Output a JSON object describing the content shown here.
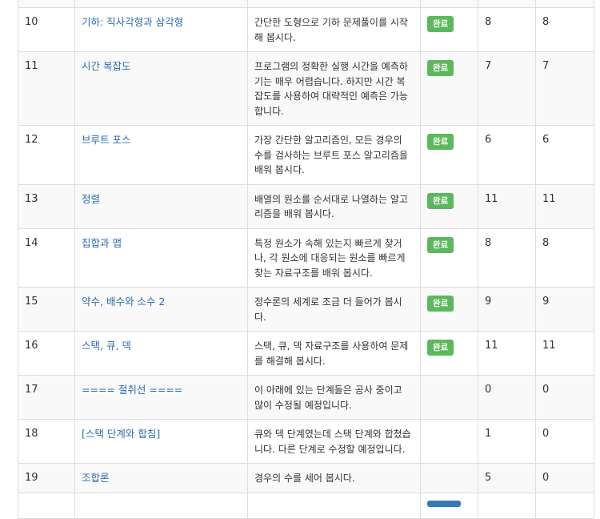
{
  "rows": [
    {
      "num": "10",
      "title": "기하: 직사각형과 삼각형",
      "desc": "간단한 도형으로 기하 문제풀이를 시작해 봅시다.",
      "status": "완료",
      "a": "8",
      "b": "8"
    },
    {
      "num": "11",
      "title": "시간 복잡도",
      "desc": "프로그램의 정확한 실행 시간을 예측하기는 매우 어렵습니다. 하지만 시간 복잡도를 사용하여 대략적인 예측은 가능합니다.",
      "status": "완료",
      "a": "7",
      "b": "7"
    },
    {
      "num": "12",
      "title": "브루트 포스",
      "desc": "가장 간단한 알고리즘인, 모든 경우의 수를 검사하는 브루트 포스 알고리즘을 배워 봅시다.",
      "status": "완료",
      "a": "6",
      "b": "6"
    },
    {
      "num": "13",
      "title": "정렬",
      "desc": "배열의 원소를 순서대로 나열하는 알고리즘을 배워 봅시다.",
      "status": "완료",
      "a": "11",
      "b": "11"
    },
    {
      "num": "14",
      "title": "집합과 맵",
      "desc": "특정 원소가 속해 있는지 빠르게 찾거나, 각 원소에 대응되는 원소를 빠르게 찾는 자료구조를 배워 봅시다.",
      "status": "완료",
      "a": "8",
      "b": "8"
    },
    {
      "num": "15",
      "title": "약수, 배수와 소수 2",
      "desc": "정수론의 세계로 조금 더 들어가 봅시다.",
      "status": "완료",
      "a": "9",
      "b": "9"
    },
    {
      "num": "16",
      "title": "스택, 큐, 덱",
      "desc": "스택, 큐, 덱 자료구조를 사용하여 문제를 해결해 봅시다.",
      "status": "완료",
      "a": "11",
      "b": "11"
    },
    {
      "num": "17",
      "title": "==== 절취선 ====",
      "desc": "이 아래에 있는 단계들은 공사 중이고 많이 수정될 예정입니다.",
      "status": "",
      "a": "0",
      "b": "0"
    },
    {
      "num": "18",
      "title": "[스택 단계와 합침]",
      "desc": "큐와 덱 단계였는데 스택 단계와 합쳤습니다. 다른 단계로 수정할 예정입니다.",
      "status": "",
      "a": "1",
      "b": "0"
    },
    {
      "num": "19",
      "title": "조합론",
      "desc": "경우의 수를 세어 봅시다.",
      "status": "",
      "a": "5",
      "b": "0"
    }
  ]
}
